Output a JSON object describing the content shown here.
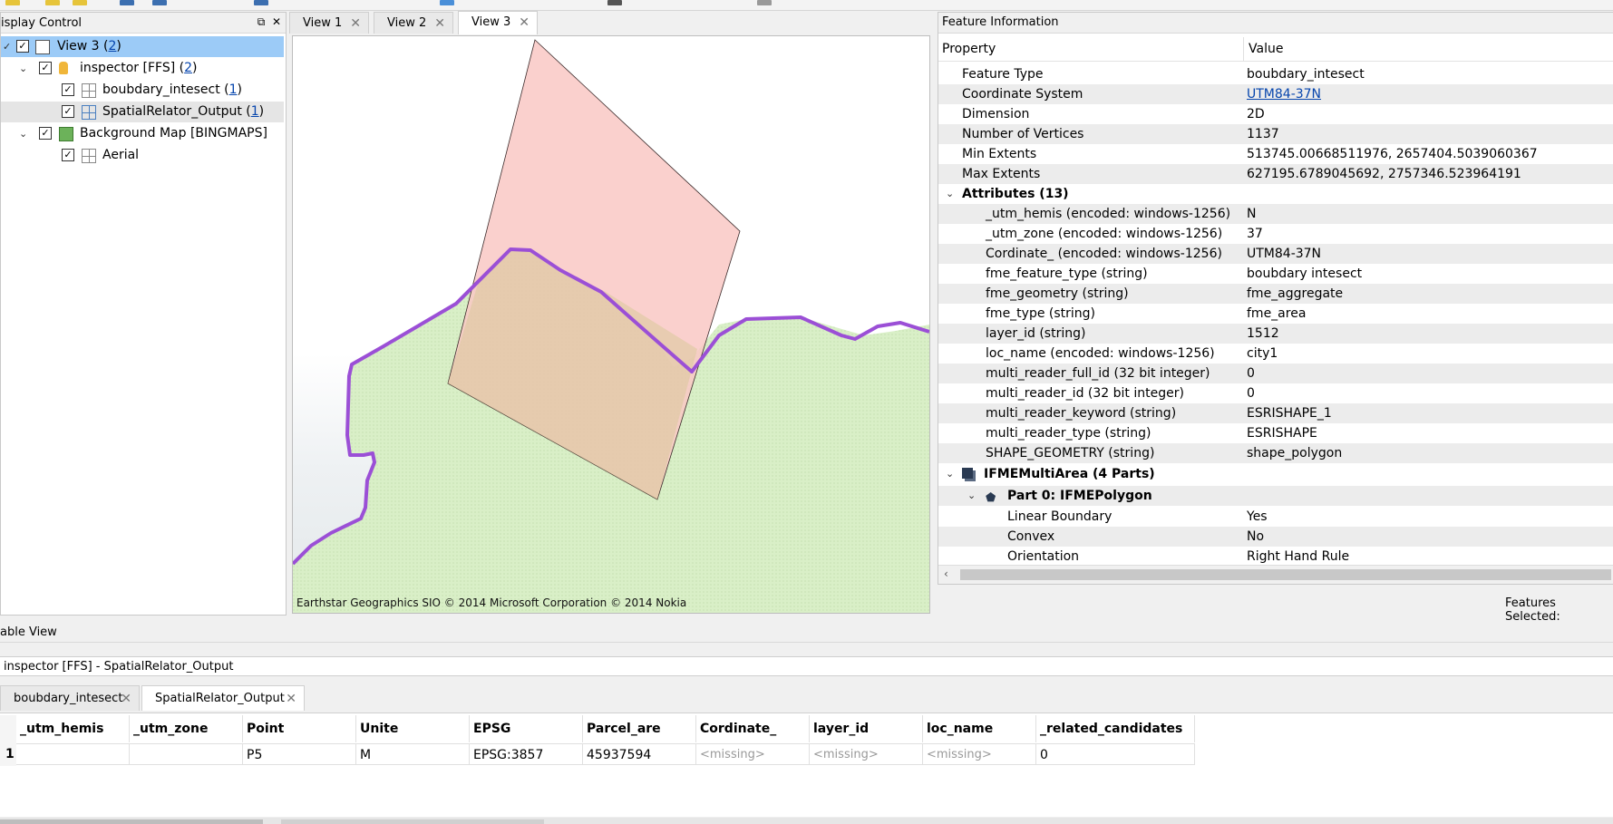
{
  "display_control": {
    "title": "isplay Control",
    "items": [
      {
        "label": "View 3 (",
        "count": "2",
        "close": ")"
      },
      {
        "label": "inspector [FFS] (",
        "count": "2",
        "close": ")"
      },
      {
        "label": "boubdary_intesect (",
        "count": "1",
        "close": ")"
      },
      {
        "label": "SpatialRelator_Output (",
        "count": "1",
        "close": ")"
      },
      {
        "label": "Background Map [BINGMAPS]"
      },
      {
        "label": "Aerial"
      }
    ]
  },
  "views": {
    "tabs": [
      "View 1",
      "View 2",
      "View 3"
    ],
    "map_attribution": "Earthstar Geographics SIO © 2014 Microsoft Corporation © 2014 Nokia"
  },
  "feature_info": {
    "title": "Feature Information",
    "header_property": "Property",
    "header_value": "Value",
    "rows": [
      {
        "p": "Feature Type",
        "v": "boubdary_intesect"
      },
      {
        "p": "Coordinate System",
        "v": "UTM84-37N"
      },
      {
        "p": "Dimension",
        "v": "2D"
      },
      {
        "p": "Number of Vertices",
        "v": "1137"
      },
      {
        "p": "Min Extents",
        "v": "513745.00668511976, 2657404.5039060367"
      },
      {
        "p": "Max Extents",
        "v": "627195.6789045692, 2757346.523964191"
      },
      {
        "p": "Attributes (13)",
        "v": ""
      },
      {
        "p": "_utm_hemis (encoded: windows-1256)",
        "v": "N"
      },
      {
        "p": "_utm_zone (encoded: windows-1256)",
        "v": "37"
      },
      {
        "p": "Cordinate_ (encoded: windows-1256)",
        "v": "UTM84-37N"
      },
      {
        "p": "fme_feature_type (string)",
        "v": "boubdary intesect"
      },
      {
        "p": "fme_geometry (string)",
        "v": "fme_aggregate"
      },
      {
        "p": "fme_type (string)",
        "v": "fme_area"
      },
      {
        "p": "layer_id (string)",
        "v": "1512"
      },
      {
        "p": "loc_name (encoded: windows-1256)",
        "v": "city1"
      },
      {
        "p": "multi_reader_full_id (32 bit integer)",
        "v": "0"
      },
      {
        "p": "multi_reader_id (32 bit integer)",
        "v": "0"
      },
      {
        "p": "multi_reader_keyword (string)",
        "v": "ESRISHAPE_1"
      },
      {
        "p": "multi_reader_type (string)",
        "v": "ESRISHAPE"
      },
      {
        "p": "SHAPE_GEOMETRY (string)",
        "v": "shape_polygon"
      },
      {
        "p": "IFMEMultiArea (4 Parts)",
        "v": ""
      },
      {
        "p": "Part 0: IFMEPolygon",
        "v": ""
      },
      {
        "p": "Linear Boundary",
        "v": "Yes"
      },
      {
        "p": "Convex",
        "v": "No"
      },
      {
        "p": "Orientation",
        "v": "Right Hand Rule"
      }
    ],
    "features_selected": "Features Selected:"
  },
  "table_view": {
    "title": "able View",
    "path": "inspector [FFS] - SpatialRelator_Output",
    "tabs": [
      "boubdary_intesect",
      "SpatialRelator_Output"
    ],
    "columns": [
      "_utm_hemis",
      "_utm_zone",
      "Point",
      "Unite",
      "EPSG",
      "Parcel_are",
      "Cordinate_",
      "layer_id",
      "loc_name",
      "_related_candidates"
    ],
    "row_number": "1",
    "row": [
      "",
      "",
      "P5",
      "M",
      "EPSG:3857",
      "45937594",
      "<missing>",
      "<missing>",
      "<missing>",
      "0"
    ]
  },
  "colors": {
    "selection": "#9ccbf7",
    "boundary": "#9b4fd6",
    "polygon_fill": "#f9c8c4",
    "land": "#d8eec4",
    "link": "#0645ad"
  }
}
